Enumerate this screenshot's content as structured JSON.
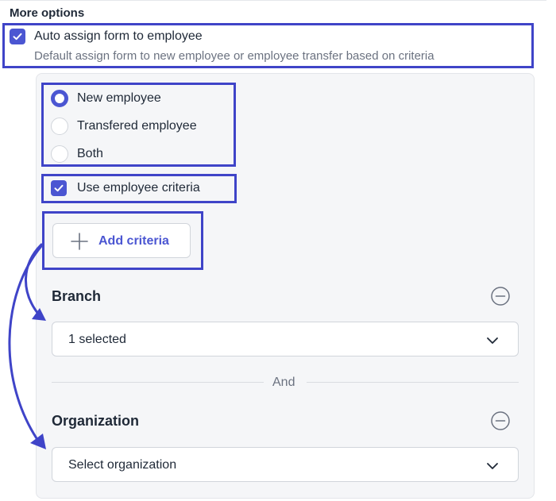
{
  "section": {
    "title": "More options"
  },
  "auto_assign": {
    "label": "Auto assign form to employee",
    "description": "Default assign form to new employee or employee transfer based on criteria",
    "checked": true
  },
  "employee_type": {
    "options": [
      {
        "label": "New employee",
        "selected": true
      },
      {
        "label": "Transfered employee",
        "selected": false
      },
      {
        "label": "Both",
        "selected": false
      }
    ]
  },
  "criteria": {
    "use_label": "Use employee criteria",
    "checked": true,
    "add_button_label": "Add criteria"
  },
  "branch": {
    "title": "Branch",
    "value": "1 selected"
  },
  "separator": {
    "label": "And"
  },
  "organization": {
    "title": "Organization",
    "placeholder": "Select organization"
  },
  "colors": {
    "accent": "#4b56d2",
    "highlight": "#3f44c8",
    "panel_bg": "#f5f6f8"
  },
  "icons": [
    "check-icon",
    "plus-icon",
    "minus-circle-icon",
    "chevron-down-icon"
  ]
}
